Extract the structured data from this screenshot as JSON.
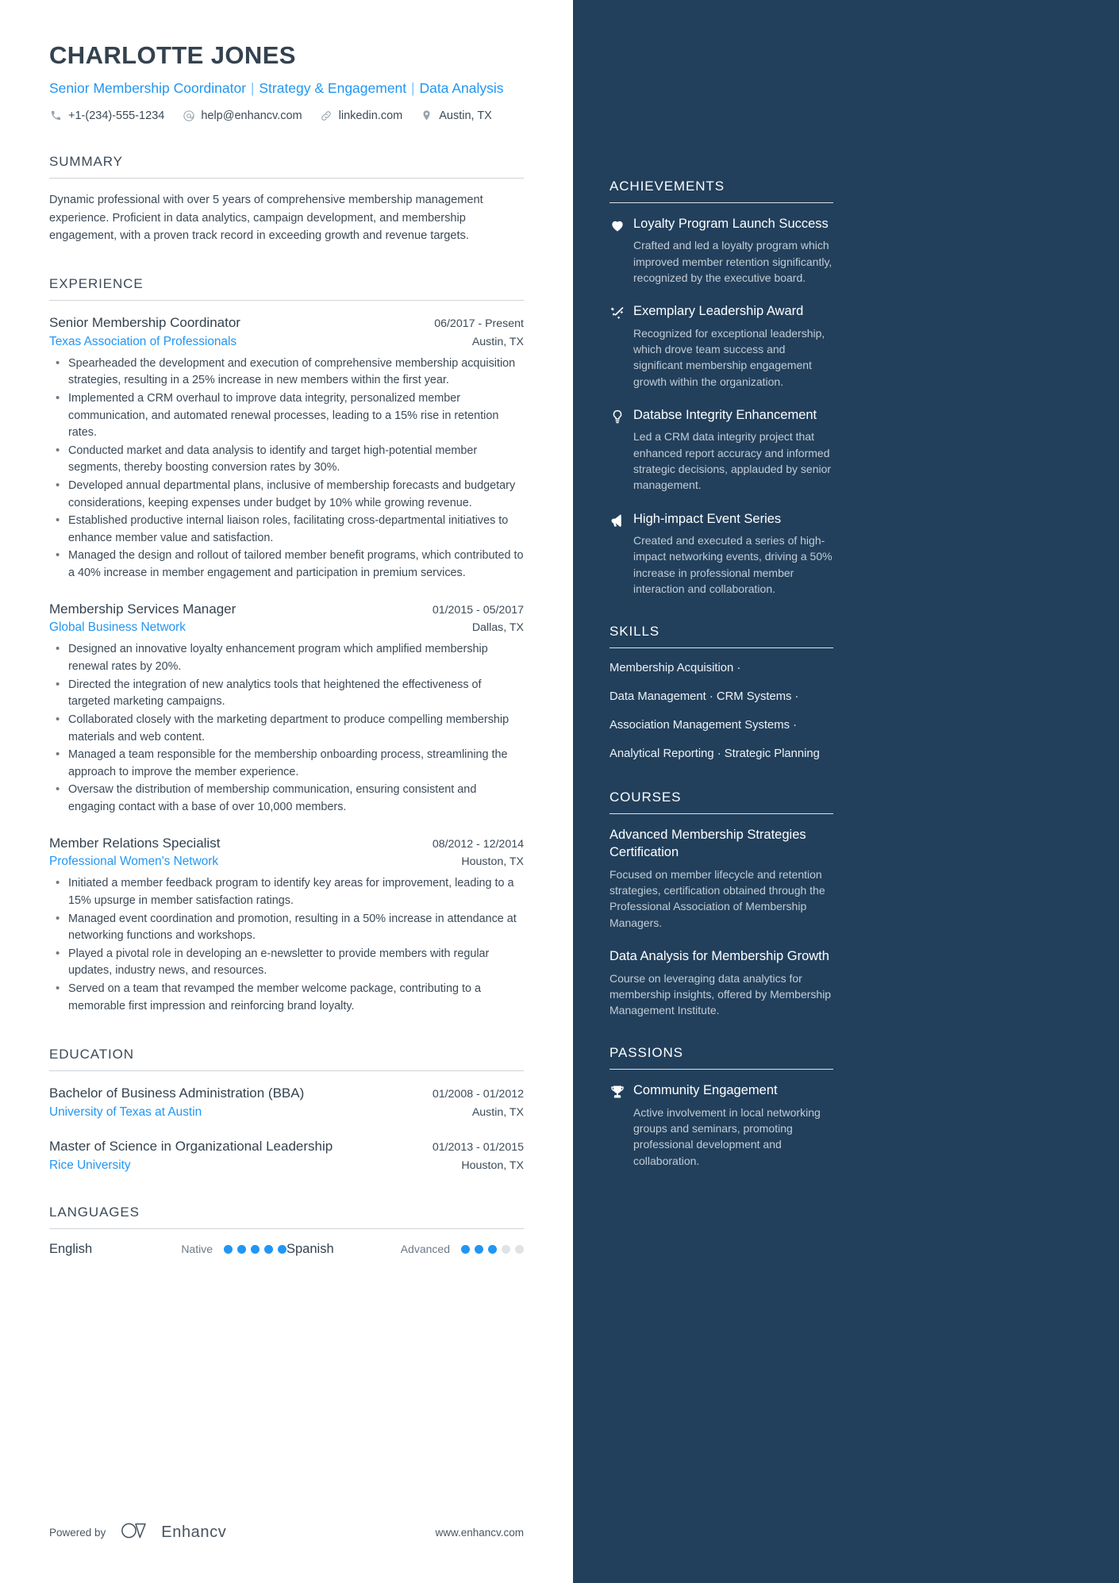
{
  "header": {
    "name": "CHARLOTTE JONES",
    "headline_parts": [
      "Senior Membership Coordinator",
      "Strategy & Engagement",
      "Data Analysis"
    ],
    "headline_separator": "|",
    "contacts": [
      {
        "icon": "phone-icon",
        "text": "+1-(234)-555-1234"
      },
      {
        "icon": "email-icon",
        "text": "help@enhancv.com"
      },
      {
        "icon": "link-icon",
        "text": "linkedin.com"
      },
      {
        "icon": "location-pin-icon",
        "text": "Austin, TX"
      }
    ]
  },
  "left": {
    "summary": {
      "title": "SUMMARY",
      "text": "Dynamic professional with over 5 years of comprehensive membership management experience. Proficient in data analytics, campaign development, and membership engagement, with a proven track record in exceeding growth and revenue targets."
    },
    "experience": {
      "title": "EXPERIENCE",
      "entries": [
        {
          "role": "Senior Membership Coordinator",
          "date": "06/2017 - Present",
          "company": "Texas Association of Professionals",
          "location": "Austin, TX",
          "bullets": [
            "Spearheaded the development and execution of comprehensive membership acquisition strategies, resulting in a 25% increase in new members within the first year.",
            "Implemented a CRM overhaul to improve data integrity, personalized member communication, and automated renewal processes, leading to a 15% rise in retention rates.",
            "Conducted market and data analysis to identify and target high-potential member segments, thereby boosting conversion rates by 30%.",
            "Developed annual departmental plans, inclusive of membership forecasts and budgetary considerations, keeping expenses under budget by 10% while growing revenue.",
            "Established productive internal liaison roles, facilitating cross-departmental initiatives to enhance member value and satisfaction.",
            "Managed the design and rollout of tailored member benefit programs, which contributed to a 40% increase in member engagement and participation in premium services."
          ]
        },
        {
          "role": "Membership Services Manager",
          "date": "01/2015 - 05/2017",
          "company": "Global Business Network",
          "location": "Dallas, TX",
          "bullets": [
            "Designed an innovative loyalty enhancement program which amplified membership renewal rates by 20%.",
            "Directed the integration of new analytics tools that heightened the effectiveness of targeted marketing campaigns.",
            "Collaborated closely with the marketing department to produce compelling membership materials and web content.",
            "Managed a team responsible for the membership onboarding process, streamlining the approach to improve the member experience.",
            "Oversaw the distribution of membership communication, ensuring consistent and engaging contact with a base of over 10,000 members."
          ]
        },
        {
          "role": "Member Relations Specialist",
          "date": "08/2012 - 12/2014",
          "company": "Professional Women's Network",
          "location": "Houston, TX",
          "bullets": [
            "Initiated a member feedback program to identify key areas for improvement, leading to a 15% upsurge in member satisfaction ratings.",
            "Managed event coordination and promotion, resulting in a 50% increase in attendance at networking functions and workshops.",
            "Played a pivotal role in developing an e-newsletter to provide members with regular updates, industry news, and resources.",
            "Served on a team that revamped the member welcome package, contributing to a memorable first impression and reinforcing brand loyalty."
          ]
        }
      ]
    },
    "education": {
      "title": "EDUCATION",
      "entries": [
        {
          "degree": "Bachelor of Business Administration (BBA)",
          "date": "01/2008 - 01/2012",
          "school": "University of Texas at Austin",
          "location": "Austin, TX"
        },
        {
          "degree": "Master of Science in Organizational Leadership",
          "date": "01/2013 - 01/2015",
          "school": "Rice University",
          "location": "Houston, TX"
        }
      ]
    },
    "languages": {
      "title": "LANGUAGES",
      "items": [
        {
          "name": "English",
          "level": "Native",
          "filled": 5,
          "total": 5
        },
        {
          "name": "Spanish",
          "level": "Advanced",
          "filled": 3,
          "total": 5
        }
      ]
    },
    "footer": {
      "powered_by": "Powered by",
      "brand": "Enhancv",
      "site": "www.enhancv.com"
    }
  },
  "right": {
    "achievements": {
      "title": "ACHIEVEMENTS",
      "items": [
        {
          "icon": "heart-icon",
          "title": "Loyalty Program Launch Success",
          "desc": "Crafted and led a loyalty program which improved member retention significantly, recognized by the executive board."
        },
        {
          "icon": "sparkle-arrow-icon",
          "title": "Exemplary Leadership Award",
          "desc": "Recognized for exceptional leadership, which drove team success and significant membership engagement growth within the organization."
        },
        {
          "icon": "lightbulb-icon",
          "title": "Databse Integrity Enhancement",
          "desc": "Led a CRM data integrity project that enhanced report accuracy and informed strategic decisions, applauded by senior management."
        },
        {
          "icon": "megaphone-icon",
          "title": "High-impact Event Series",
          "desc": "Created and executed a series of high-impact networking events, driving a 50% increase in professional member interaction and collaboration."
        }
      ]
    },
    "skills": {
      "title": "SKILLS",
      "lines": [
        "Membership Acquisition ·",
        "Data Management · CRM Systems ·",
        "Association Management Systems ·",
        "Analytical Reporting · Strategic Planning"
      ]
    },
    "courses": {
      "title": "COURSES",
      "items": [
        {
          "title": "Advanced Membership Strategies Certification",
          "desc": "Focused on member lifecycle and retention strategies, certification obtained through the Professional Association of Membership Managers."
        },
        {
          "title": "Data Analysis for Membership Growth",
          "desc": "Course on leveraging data analytics for membership insights, offered by Membership Management Institute."
        }
      ]
    },
    "passions": {
      "title": "PASSIONS",
      "items": [
        {
          "icon": "trophy-icon",
          "title": "Community Engagement",
          "desc": "Active involvement in local networking groups and seminars, promoting professional development and collaboration."
        }
      ]
    }
  },
  "colors": {
    "sidebar_bg": "#22405c",
    "accent_blue": "#2196f3",
    "text_dark": "#3c4a57",
    "heading_dark": "#34424f"
  }
}
